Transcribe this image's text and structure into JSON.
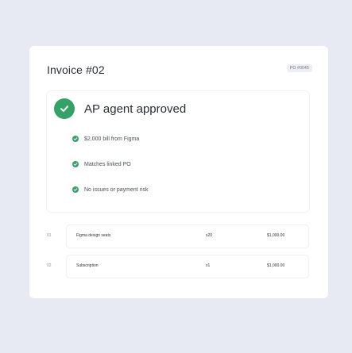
{
  "invoice": {
    "title": "Invoice #02",
    "po_badge": "PO #0045"
  },
  "approval": {
    "title": "AP agent approved",
    "status_color": "#34a266",
    "checks": [
      {
        "label": "$2,000 bill from Figma"
      },
      {
        "label": "Matches linked PO"
      },
      {
        "label": "No issues or payment risk"
      }
    ]
  },
  "line_items": [
    {
      "number": "01",
      "name": "Figma design seats",
      "quantity": "x20",
      "amount": "$1,000.00"
    },
    {
      "number": "02",
      "name": "Subscription",
      "quantity": "x1",
      "amount": "$1,000.00"
    }
  ]
}
